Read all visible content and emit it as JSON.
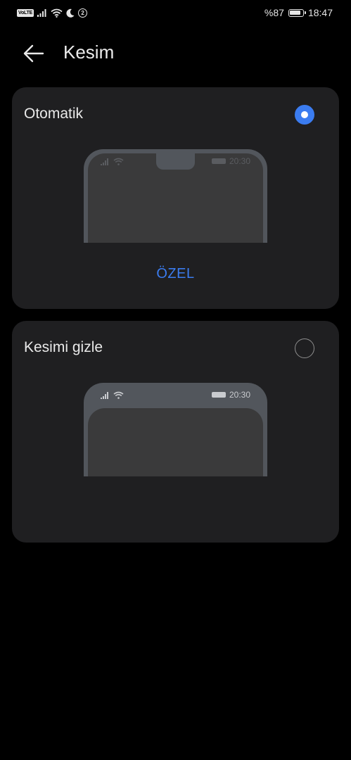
{
  "status_bar": {
    "volte": "VoLTE",
    "sim_badge": "2",
    "battery_text": "%87",
    "battery_level": 0.87,
    "time": "18:47"
  },
  "header": {
    "title": "Kesim"
  },
  "options": [
    {
      "label": "Otomatik",
      "selected": true,
      "preview_time": "20:30",
      "custom_link": "ÖZEL"
    },
    {
      "label": "Kesimi gizle",
      "selected": false,
      "preview_time": "20:30"
    }
  ],
  "colors": {
    "accent": "#3b7cf0",
    "card_bg": "#1f1f21",
    "page_bg": "#000000"
  }
}
